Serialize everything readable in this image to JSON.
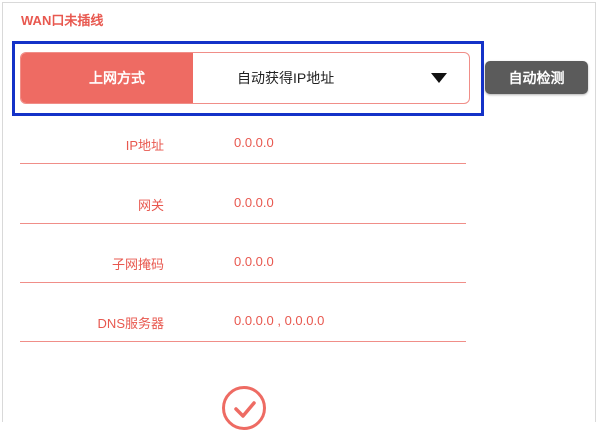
{
  "wan_status": {
    "title": "WAN口未插线"
  },
  "connection": {
    "label": "上网方式",
    "selected_option": "自动获得IP地址",
    "detect_button": "自动检测"
  },
  "fields": [
    {
      "label": "IP地址",
      "value": "0.0.0.0"
    },
    {
      "label": "网关",
      "value": "0.0.0.0"
    },
    {
      "label": "子网掩码",
      "value": "0.0.0.0"
    },
    {
      "label": "DNS服务器",
      "value": "0.0.0.0 , 0.0.0.0"
    }
  ],
  "icons": {
    "dropdown": "caret-down-icon",
    "confirm": "checkmark-icon"
  },
  "colors": {
    "accent": "#ee6b63",
    "highlight_border": "#1432c8",
    "button_dark": "#5b5b5b"
  }
}
